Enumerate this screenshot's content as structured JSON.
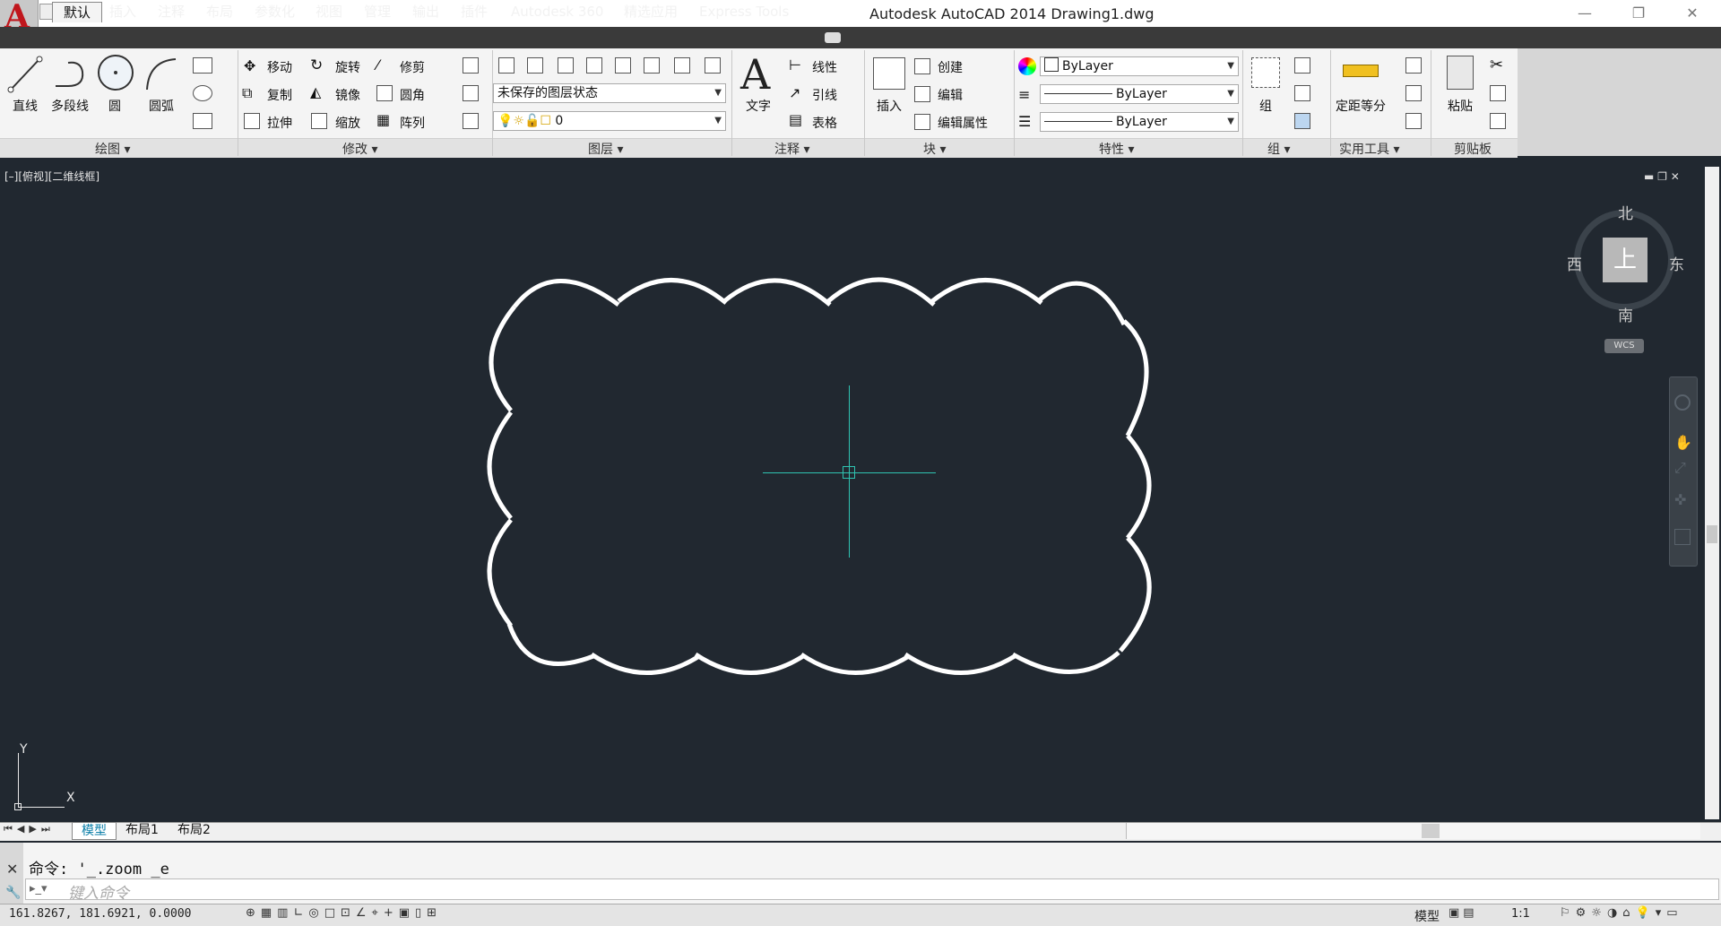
{
  "window": {
    "title": "Autodesk AutoCAD 2014    Drawing1.dwg",
    "app_logo": "A",
    "minimize": "—",
    "restore": "❐",
    "close": "✕"
  },
  "tabs": [
    "默认",
    "插入",
    "注释",
    "布局",
    "参数化",
    "视图",
    "管理",
    "输出",
    "插件",
    "Autodesk 360",
    "精选应用",
    "Express Tools"
  ],
  "draw_panel": {
    "title": "绘图 ▾",
    "line": "直线",
    "polyline": "多段线",
    "circle": "圆",
    "arc": "圆弧"
  },
  "modify_panel": {
    "title": "修改 ▾",
    "move": "移动",
    "rotate": "旋转",
    "trim": "修剪",
    "copy": "复制",
    "mirror": "镜像",
    "fillet": "圆角",
    "stretch": "拉伸",
    "scale": "缩放",
    "array": "阵列"
  },
  "layer_panel": {
    "title": "图层 ▾",
    "layer_state": "未保存的图层状态",
    "layer_name": "0"
  },
  "annotation_panel": {
    "title": "注释 ▾",
    "text": "文字",
    "linear": "线性",
    "leader": "引线",
    "table": "表格"
  },
  "block_panel": {
    "title": "块 ▾",
    "insert": "插入",
    "create": "创建",
    "edit": "编辑",
    "edit_attr": "编辑属性"
  },
  "properties_panel": {
    "title": "特性 ▾",
    "color": "ByLayer",
    "linetype": "ByLayer",
    "lineweight": "ByLayer"
  },
  "group_panel": {
    "title": "组 ▾",
    "group": "组"
  },
  "utilities_panel": {
    "title": "实用工具 ▾",
    "measure": "定距等分"
  },
  "clipboard_panel": {
    "title": "剪贴板",
    "paste": "粘贴"
  },
  "viewport": {
    "label": "[–][俯视][二维线框]",
    "controls": "▬ ❐ ✕",
    "compass": {
      "north": "北",
      "south": "南",
      "east": "东",
      "west": "西",
      "top": "上",
      "wcs": "WCS"
    },
    "ucs": {
      "x": "X",
      "y": "Y"
    }
  },
  "layouts": [
    "模型",
    "布局1",
    "布局2"
  ],
  "command": {
    "history": "命令: '_.zoom _e",
    "placeholder": "键入命令"
  },
  "status": {
    "coords": "161.8267, 181.6921, 0.0000",
    "model": "模型",
    "scale": "1:1"
  },
  "colors": {
    "canvas": "#212830",
    "crosshair": "#2fc4b2",
    "cloud": "#ffffff"
  }
}
